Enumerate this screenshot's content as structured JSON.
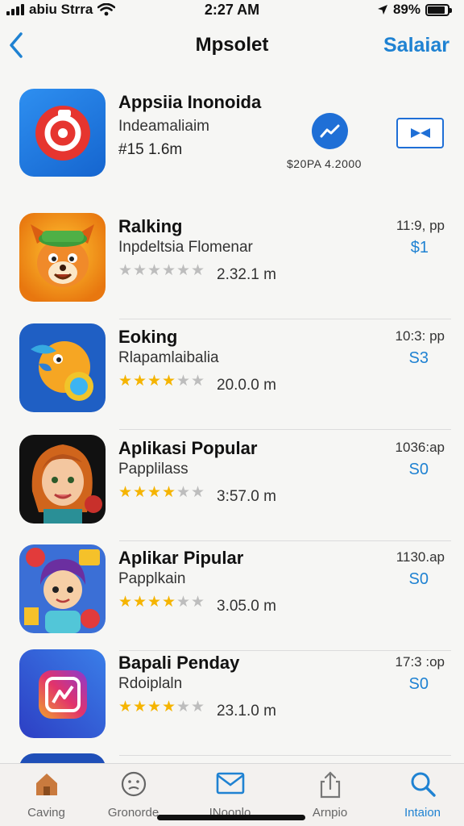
{
  "status": {
    "carrier": "abiu Strra",
    "time": "2:27 AM",
    "battery": "89%",
    "battery_level": 0.89
  },
  "nav": {
    "title": "Mpsolet",
    "action": "Salaiar"
  },
  "featured": {
    "title": "Appsiia Inonoida",
    "subtitle": "Indeamaliaim",
    "meta": "#15 1.6m",
    "price": "$20PA 4.2000",
    "icon": "camera-icon"
  },
  "apps": [
    {
      "name": "Ralking",
      "subtitle": "Inpdeltsia Flomenar",
      "rating": 0,
      "size": "2.32.1 m",
      "time": "11:9, pp",
      "price": "$1",
      "icon": "fox-character-icon"
    },
    {
      "name": "Eoking",
      "subtitle": "Rlapamlaibalia",
      "rating": 4,
      "size": "20.0.0 m",
      "time": "10:3: pp",
      "price": "S3",
      "icon": "bird-character-icon"
    },
    {
      "name": "Aplikasi Popular",
      "subtitle": "Papplilass",
      "rating": 4,
      "size": "3:57.0 m",
      "time": "1036:ap",
      "price": "S0",
      "icon": "girl-portrait-icon"
    },
    {
      "name": "Aplikar Pipular",
      "subtitle": "Papplkain",
      "rating": 4,
      "size": "3.05.0 m",
      "time": "1130.ap",
      "price": "S0",
      "icon": "cartoon-kid-icon"
    },
    {
      "name": "Bapali Penday",
      "subtitle": "Rdoiplaln",
      "rating": 4,
      "size": "23.1.0 m",
      "time": "17:3 :op",
      "price": "S0",
      "icon": "instagram-like-icon"
    }
  ],
  "tabs": [
    {
      "label": "Caving",
      "icon": "home-icon",
      "active": false
    },
    {
      "label": "Gronorde",
      "icon": "face-icon",
      "active": false
    },
    {
      "label": "INoonlo",
      "icon": "mail-icon",
      "active": false
    },
    {
      "label": "Arnpio",
      "icon": "share-icon",
      "active": false
    },
    {
      "label": "Intaion",
      "icon": "search-icon",
      "active": true
    }
  ],
  "colors": {
    "accent": "#1f82d2",
    "star_filled": "#f5b400",
    "star_empty": "#bdbdbd"
  }
}
